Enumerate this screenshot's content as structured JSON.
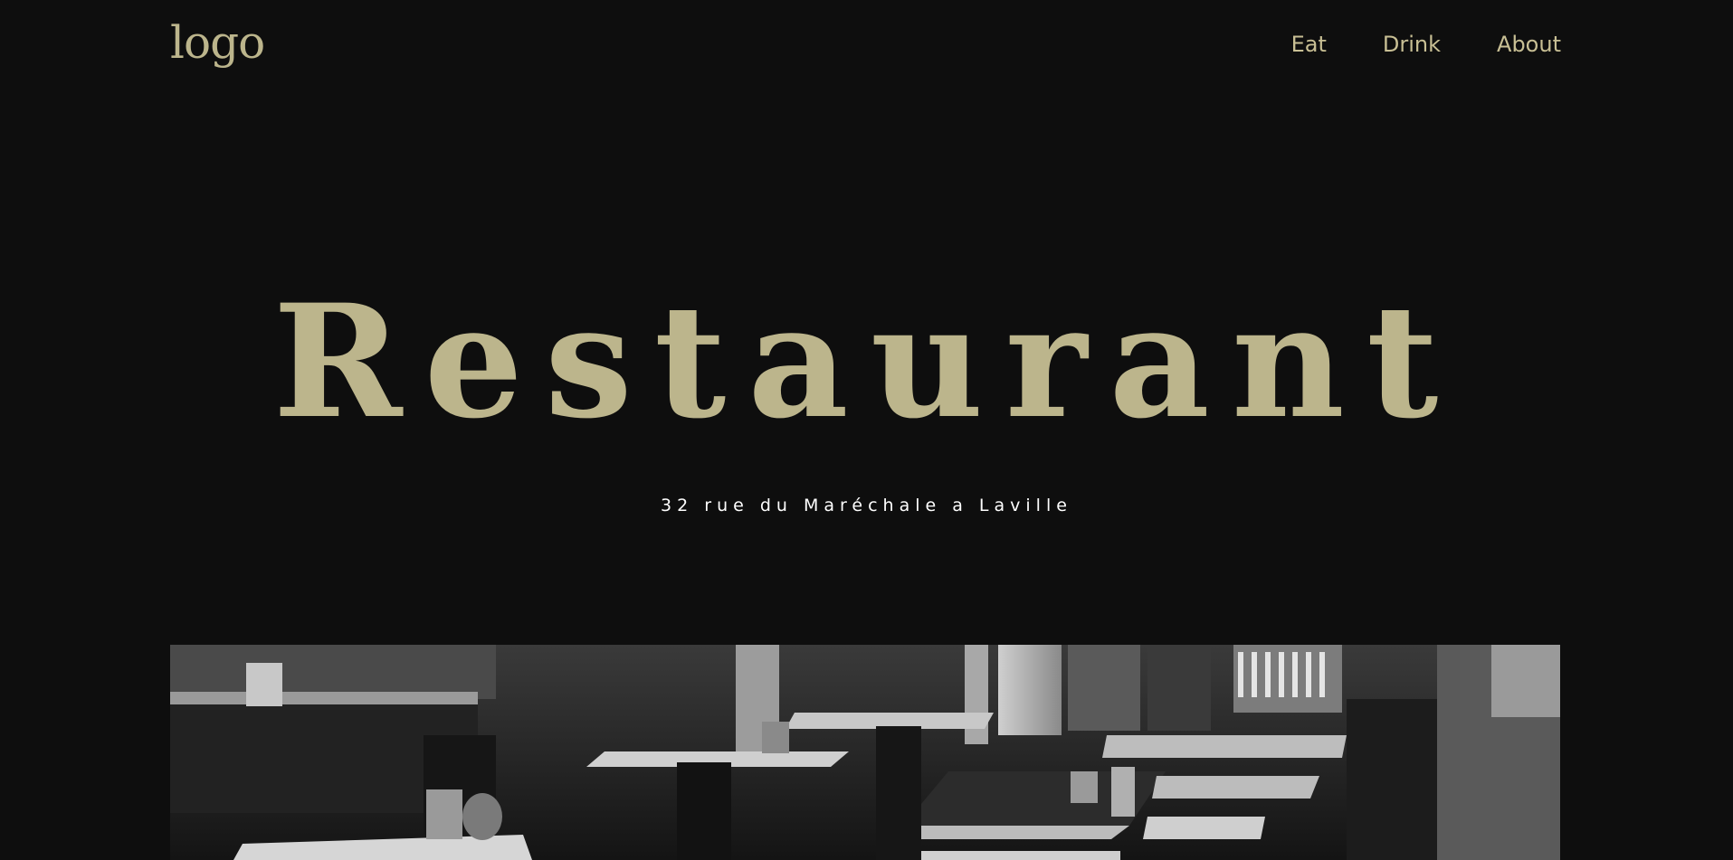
{
  "header": {
    "logo": "logo",
    "nav": [
      {
        "label": "Eat"
      },
      {
        "label": "Drink"
      },
      {
        "label": "About"
      }
    ]
  },
  "hero": {
    "title": "Restaurant",
    "address": "32 rue du Maréchale a Laville"
  },
  "colors": {
    "background": "#0e0e0e",
    "accent": "#bcb58c",
    "address_text": "#ffffff"
  }
}
